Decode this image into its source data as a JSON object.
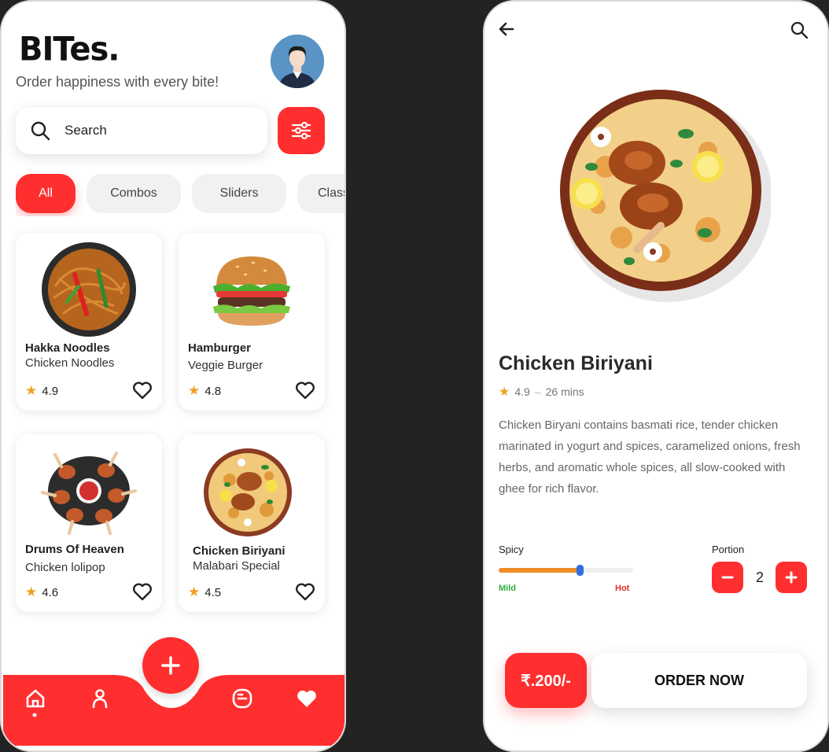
{
  "home": {
    "brand": "BITes.",
    "tagline": "Order happiness with every bite!",
    "search": {
      "placeholder": "Search"
    },
    "categories": [
      "All",
      "Combos",
      "Sliders",
      "Class"
    ],
    "products": [
      {
        "title": "Hakka Noodles",
        "subtitle": "Chicken Noodles",
        "rating": "4.9"
      },
      {
        "title": "Hamburger",
        "subtitle": "Veggie Burger",
        "rating": "4.8"
      },
      {
        "title": "Drums Of  Heaven",
        "subtitle": "Chicken lolipop",
        "rating": "4.6"
      },
      {
        "title": "Chicken Biriyani",
        "subtitle": "Malabari Special",
        "rating": "4.5"
      }
    ]
  },
  "detail": {
    "title": "Chicken Biriyani",
    "rating": "4.9",
    "separator": "–",
    "time": "26 mins",
    "description": "Chicken Biryani contains basmati rice, tender chicken marinated in yogurt and spices, caramelized onions, fresh herbs, and aromatic whole spices, all slow-cooked with ghee for rich flavor.",
    "spicy": {
      "label": "Spicy",
      "min_label": "Mild",
      "max_label": "Hot",
      "level": 0.6
    },
    "portion": {
      "label": "Portion",
      "value": "2"
    },
    "price": "₹.200/-",
    "order_label": "ORDER NOW"
  },
  "colors": {
    "accent": "#ff2f2f",
    "star": "#f0a020",
    "slider": "#f28c28",
    "thumb": "#2f6fe0",
    "mild": "#2fae3f",
    "hot": "#e02e2e"
  },
  "icons": [
    "search-icon",
    "filter-icon",
    "heart-icon",
    "star-icon",
    "plus-icon",
    "home-icon",
    "profile-icon",
    "chat-icon",
    "back-arrow-icon",
    "minus-icon"
  ]
}
